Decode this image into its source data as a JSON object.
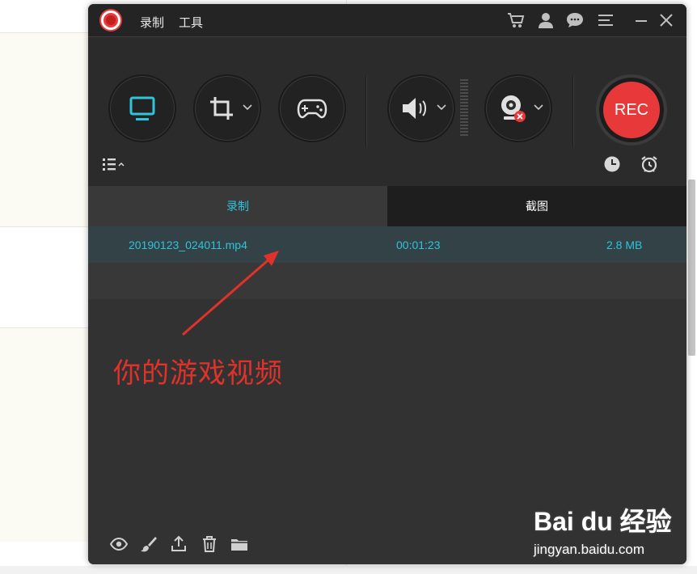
{
  "titlebar": {
    "menu_record": "录制",
    "menu_tools": "工具",
    "icons": [
      "cart-icon",
      "account-icon",
      "chat-icon",
      "menu-icon",
      "minimize-icon",
      "close-icon"
    ]
  },
  "toolbar": {
    "modes": [
      "screen-icon",
      "crop-region-icon",
      "gamepad-icon"
    ],
    "audio_icon": "speaker-icon",
    "webcam_icon": "webcam-icon",
    "rec_label": "REC"
  },
  "tabs": {
    "record": "录制",
    "screenshot": "截图",
    "active": "record"
  },
  "recordings": [
    {
      "filename": "20190123_024011.mp4",
      "duration": "00:01:23",
      "size": "2.8 MB"
    }
  ],
  "annotation": {
    "text": "你的游戏视频"
  },
  "bottom_icons": [
    "eye-icon",
    "brush-icon",
    "share-icon",
    "trash-icon",
    "folder-icon"
  ],
  "watermark": {
    "brand": "Bai du 经验",
    "url": "jingyan.baidu.com"
  },
  "colors": {
    "accent": "#2ec4d9",
    "rec": "#e8393a",
    "annotation": "#e0322a"
  }
}
